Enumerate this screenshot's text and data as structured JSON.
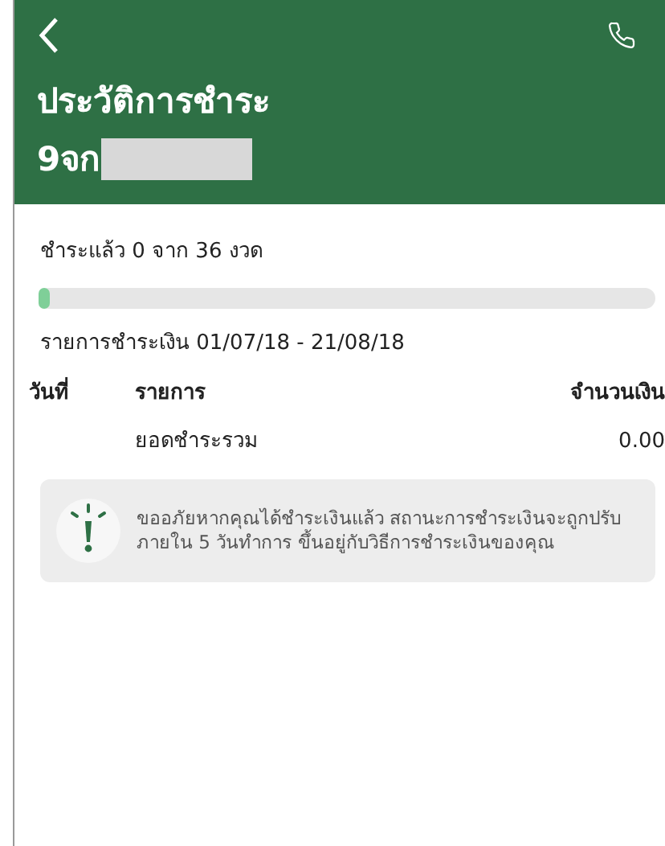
{
  "header": {
    "title": "ประวัติการชำระ",
    "subtitle": "9จก"
  },
  "progress": {
    "label": "ชำระแล้ว 0 จาก 36 งวด",
    "level": 0
  },
  "period": "รายการชำระเงิน 01/07/18 - 21/08/18",
  "table": {
    "columns": [
      "วันที่",
      "รายการ",
      "จำนวนเงิน"
    ],
    "rows": [
      {
        "item": "ยอดชำระรวม",
        "amount": "0.00"
      }
    ]
  },
  "notice": "ขออภัยหากคุณได้ชำระเงินแล้ว สถานะการชำระเงินจะถูกปรับภายใน 5 วันทำการ ขึ้นอยู่กับวิธีการชำระเงินของคุณ"
}
